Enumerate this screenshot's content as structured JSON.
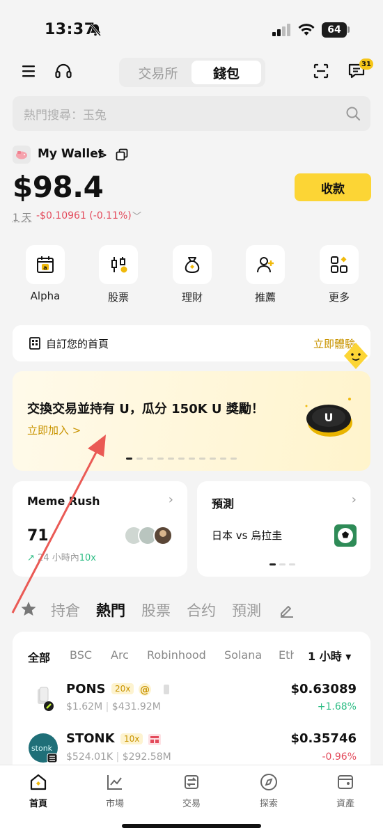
{
  "status": {
    "time": "13:37",
    "battery": "64"
  },
  "header": {
    "seg_exchange": "交易所",
    "seg_wallet": "錢包",
    "msg_badge": "31"
  },
  "search": {
    "placeholder": "熱門搜尋：玉兔"
  },
  "wallet": {
    "name": "My Wallet",
    "chevron": ">",
    "balance": "$98.4",
    "receive_label": "收款",
    "pnl_period": "1 天",
    "pnl_value": "-$0.10961 (-0.11%)"
  },
  "quick_actions": [
    {
      "label": "Alpha",
      "icon": "alpha-calendar-icon"
    },
    {
      "label": "股票",
      "icon": "stock-candles-icon"
    },
    {
      "label": "理財",
      "icon": "money-bag-icon"
    },
    {
      "label": "推薦",
      "icon": "referral-user-icon"
    },
    {
      "label": "更多",
      "icon": "more-grid-icon"
    }
  ],
  "customize": {
    "text": "自訂您的首頁",
    "cta": "立即體驗"
  },
  "promo": {
    "title": "交換交易並持有 U，瓜分 150K U 獎勵！",
    "link": "立即加入 >",
    "slides_total": 11,
    "active_slide": 1
  },
  "cards": {
    "meme": {
      "title": "Meme Rush",
      "count": "71",
      "sub_prefix": "24 小時內",
      "sub_value": "10x"
    },
    "prediction": {
      "title": "預測",
      "match": "日本 vs 烏拉圭"
    }
  },
  "tabs": [
    "持倉",
    "熱門",
    "股票",
    "合约",
    "預測"
  ],
  "active_tab": "熱門",
  "chains": [
    "全部",
    "BSC",
    "Arc",
    "Robinhood",
    "Solana",
    "Eth"
  ],
  "interval": "1 小時 ▾",
  "tokens": [
    {
      "name": "PONS",
      "leverage": "20x",
      "mcap": "$1.62M",
      "volume": "$431.92M",
      "price": "$0.63089",
      "change": "+1.68%",
      "direction": "up"
    },
    {
      "name": "STONK",
      "leverage": "10x",
      "mcap": "$524.01K",
      "volume": "$292.58M",
      "price": "$0.35746",
      "change": "-0.96%",
      "direction": "down",
      "icon_text": "stonk"
    }
  ],
  "bottom_nav": [
    {
      "label": "首頁",
      "icon": "home-icon"
    },
    {
      "label": "市場",
      "icon": "market-chart-icon"
    },
    {
      "label": "交易",
      "icon": "trade-swap-icon"
    },
    {
      "label": "探索",
      "icon": "discover-compass-icon"
    },
    {
      "label": "資產",
      "icon": "assets-wallet-icon"
    }
  ],
  "colors": {
    "brand_yellow": "#fcd535",
    "up": "#2ebd85",
    "down": "#e34a5b",
    "accent_text": "#c99400"
  }
}
